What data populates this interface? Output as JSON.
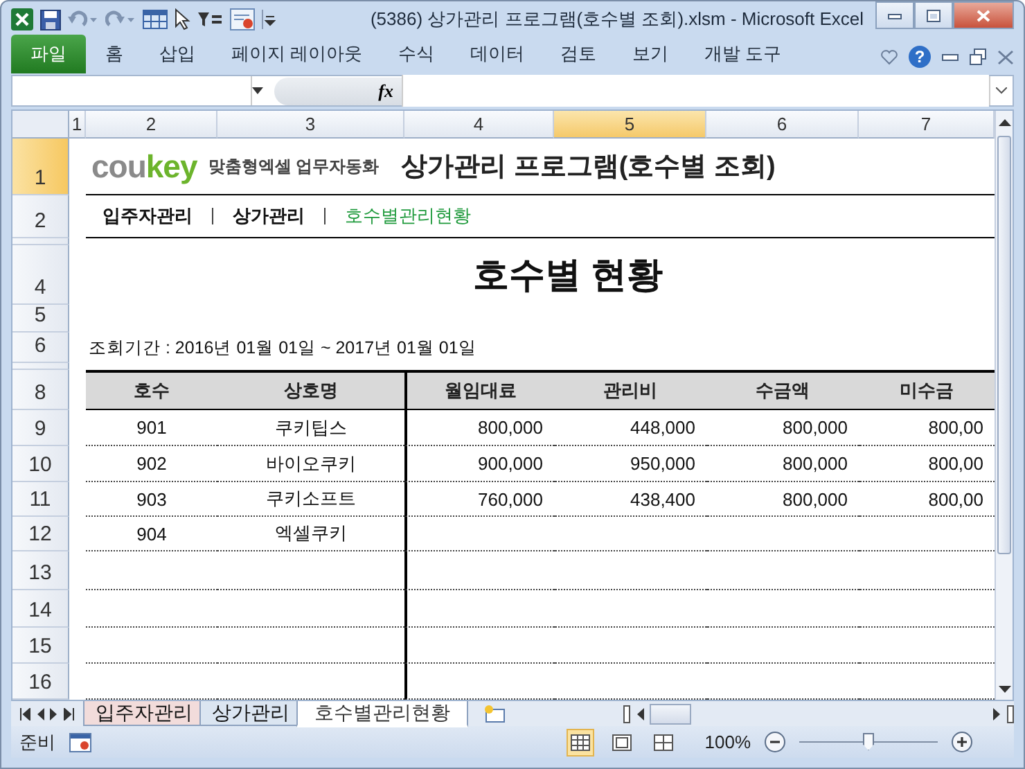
{
  "window": {
    "title": "(5386) 상가관리 프로그램(호수별 조회).xlsm  -  Microsoft Excel"
  },
  "ribbon_tabs": [
    {
      "label": "파일",
      "kind": "file"
    },
    {
      "label": "홈",
      "kind": "tab"
    },
    {
      "label": "삽입",
      "kind": "tab"
    },
    {
      "label": "페이지 레이아웃",
      "kind": "tab"
    },
    {
      "label": "수식",
      "kind": "tab"
    },
    {
      "label": "데이터",
      "kind": "tab"
    },
    {
      "label": "검토",
      "kind": "tab"
    },
    {
      "label": "보기",
      "kind": "tab"
    },
    {
      "label": "개발 도구",
      "kind": "tab"
    }
  ],
  "help": "?",
  "formula_bar": {
    "fx": "fx"
  },
  "column_headers": [
    {
      "label": "1",
      "selected": false
    },
    {
      "label": "2",
      "selected": false
    },
    {
      "label": "3",
      "selected": false
    },
    {
      "label": "4",
      "selected": false
    },
    {
      "label": "5",
      "selected": true
    },
    {
      "label": "6",
      "selected": false
    },
    {
      "label": "7",
      "selected": false
    }
  ],
  "row_headers": [
    {
      "label": "1",
      "selected": true
    },
    {
      "label": "2",
      "selected": false
    },
    {
      "selected": false
    },
    {
      "label": "4",
      "selected": false
    },
    {
      "label": "5",
      "selected": false
    },
    {
      "label": "6",
      "selected": false
    },
    {
      "selected": false
    },
    {
      "label": "8",
      "selected": false
    },
    {
      "label": "9",
      "selected": false
    },
    {
      "label": "10",
      "selected": false
    },
    {
      "label": "11",
      "selected": false
    },
    {
      "label": "12",
      "selected": false
    },
    {
      "label": "13",
      "selected": false
    },
    {
      "label": "14",
      "selected": false
    },
    {
      "label": "15",
      "selected": false
    },
    {
      "label": "16",
      "selected": false
    }
  ],
  "sheet": {
    "brand_parts": [
      {
        "text": "cou",
        "color": "#8a8a8a"
      },
      {
        "text": "key",
        "color": "#6cb42c"
      }
    ],
    "tagline": "맞춤형엑셀 업무자동화",
    "title": "상가관리 프로그램(호수별 조회)",
    "nav": [
      {
        "label": "입주자관리",
        "selected": false
      },
      {
        "label": "상가관리",
        "selected": false
      },
      {
        "label": "호수별관리현황",
        "selected": true
      }
    ],
    "heading": "호수별 현황",
    "period": "조회기간 : 2016년 01월 01일 ~ 2017년 01월 01일",
    "columns": [
      "호수",
      "상호명",
      "월임대료",
      "관리비",
      "수금액",
      "미수금"
    ],
    "rows": [
      [
        "901",
        "쿠키팁스",
        "800,000",
        "448,000",
        "800,000",
        "800,00"
      ],
      [
        "902",
        "바이오쿠키",
        "900,000",
        "950,000",
        "800,000",
        "800,00"
      ],
      [
        "903",
        "쿠키소프트",
        "760,000",
        "438,400",
        "800,000",
        "800,00"
      ],
      [
        "904",
        "엑셀쿠키"
      ]
    ]
  },
  "sheet_tabs": [
    {
      "label": "입주자관리",
      "selected": false,
      "color": "#f2dcdb"
    },
    {
      "label": "상가관리",
      "selected": false,
      "color": "#dbe5f1"
    },
    {
      "label": "호수별관리현황",
      "selected": true,
      "color": "#ffffff"
    }
  ],
  "status_bar": {
    "ready": "준비",
    "views": [
      {
        "selected": true
      },
      {
        "selected": false
      },
      {
        "selected": false
      }
    ],
    "zoom": "100%",
    "level": 0.5
  }
}
